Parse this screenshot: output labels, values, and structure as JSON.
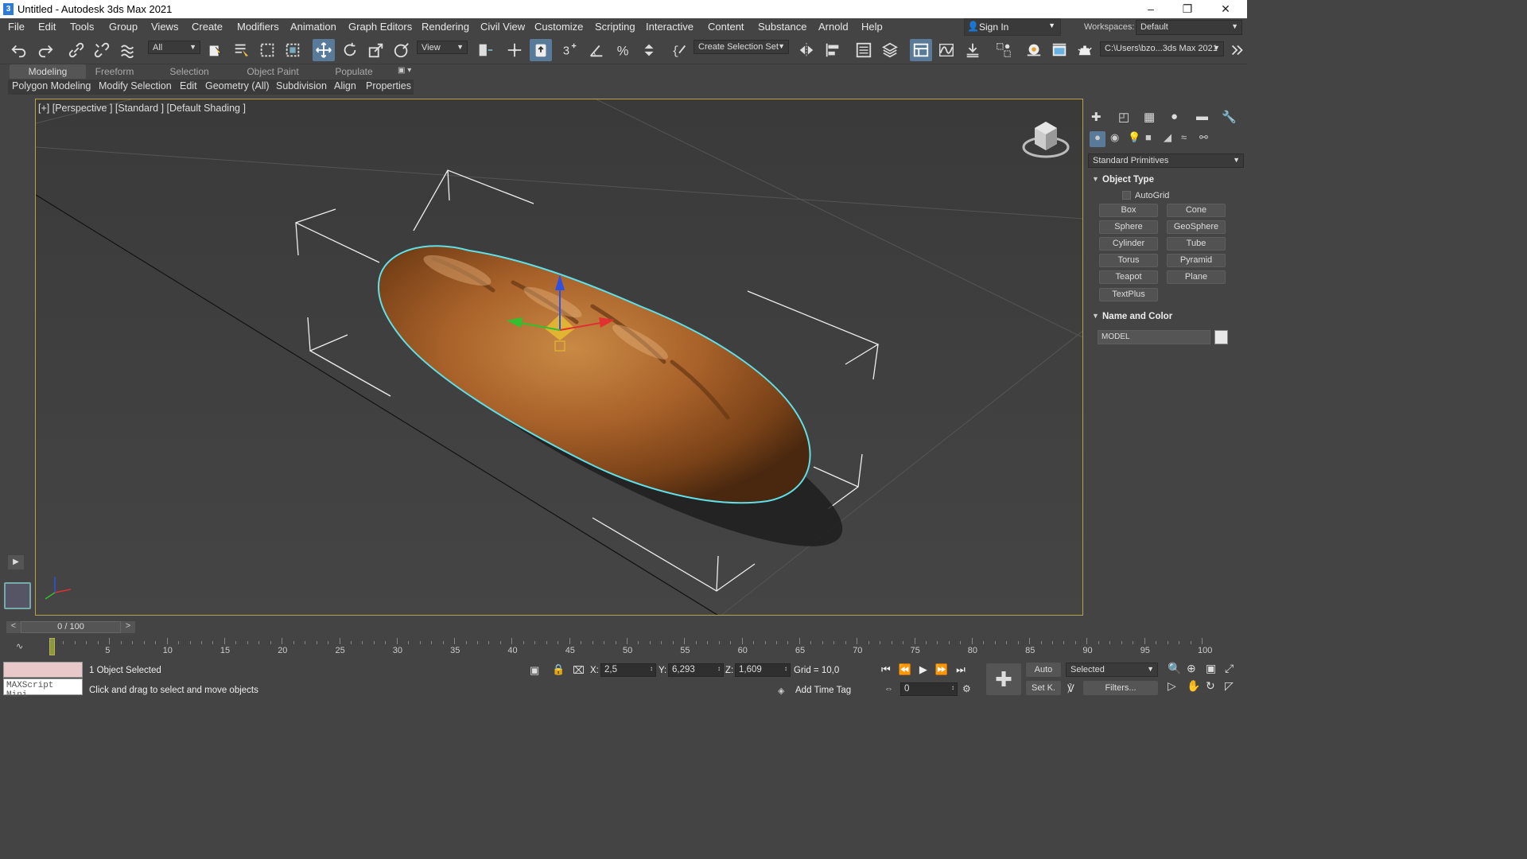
{
  "window": {
    "title": "Untitled - Autodesk 3ds Max 2021",
    "app_icon": "3"
  },
  "menu": [
    "File",
    "Edit",
    "Tools",
    "Group",
    "Views",
    "Create",
    "Modifiers",
    "Animation",
    "Graph Editors",
    "Rendering",
    "Civil View",
    "Customize",
    "Scripting",
    "Interactive",
    "Content",
    "Substance",
    "Arnold",
    "Help"
  ],
  "signin": {
    "label": "Sign In"
  },
  "workspaces": {
    "label": "Workspaces:",
    "value": "Default"
  },
  "toolbar": {
    "filter_value": "All",
    "refcoord_value": "View",
    "selection_set_value": "Create Selection Set",
    "project_path": "C:\\Users\\bzo...3ds Max 2021"
  },
  "ribbon": {
    "tabs": [
      "Modeling",
      "Freeform",
      "Selection",
      "Object Paint",
      "Populate"
    ],
    "panels": [
      "Polygon Modeling",
      "Modify Selection",
      "Edit",
      "Geometry (All)",
      "Subdivision",
      "Align",
      "Properties"
    ]
  },
  "viewport": {
    "label": "[+] [Perspective ] [Standard ] [Default Shading ]"
  },
  "command_panel": {
    "category_value": "Standard Primitives",
    "object_type_title": "Object Type",
    "autogrid_label": "AutoGrid",
    "buttons": [
      "Box",
      "Cone",
      "Sphere",
      "GeoSphere",
      "Cylinder",
      "Tube",
      "Torus",
      "Pyramid",
      "Teapot",
      "Plane",
      "TextPlus"
    ],
    "name_color_title": "Name and Color",
    "object_name": "MODEL",
    "object_color": "#e8e8e8"
  },
  "timeline": {
    "frame_display": "0 / 100",
    "ticks": [
      "5",
      "10",
      "15",
      "20",
      "25",
      "30",
      "35",
      "40",
      "45",
      "50",
      "55",
      "60",
      "65",
      "70",
      "75",
      "80",
      "85",
      "90",
      "95",
      "100"
    ]
  },
  "status": {
    "maxscript_label": "MAXScript Mini",
    "selection_info": "1 Object Selected",
    "prompt": "Click and drag to select and move objects",
    "x_label": "X:",
    "x_value": "2,5",
    "y_label": "Y:",
    "y_value": "6,293",
    "z_label": "Z:",
    "z_value": "1,609",
    "grid": "Grid = 10,0",
    "add_time_tag": "Add Time Tag",
    "auto_label": "Auto",
    "setkey_label": "Set K.",
    "key_filter_value": "Selected",
    "filters_label": "Filters...",
    "current_frame": "0"
  },
  "colors": {
    "selection_outline": "#5fe0e8",
    "viewport_border": "#b8a24a",
    "accent": "#5a7a9a"
  }
}
